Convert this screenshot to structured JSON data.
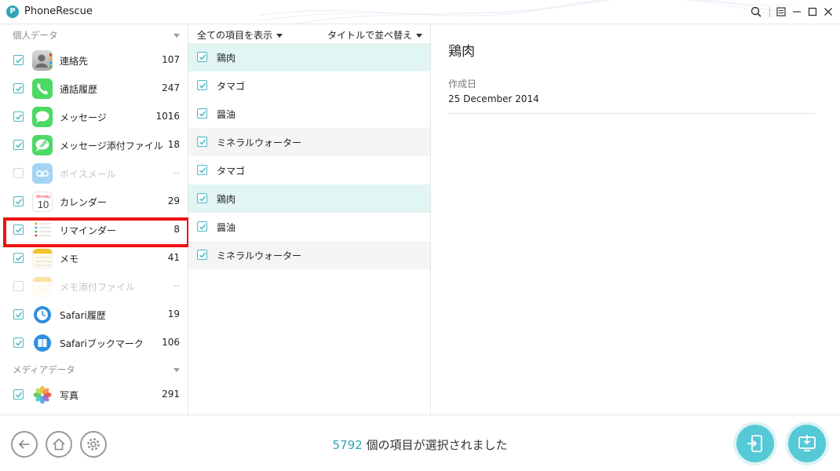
{
  "app": {
    "title": "PhoneRescue",
    "logo_letter": "P"
  },
  "sidebar": {
    "section_personal": "個人データ",
    "section_media": "メディアデータ",
    "items": [
      {
        "label": "連絡先",
        "count": "107",
        "icon": "contacts-icon",
        "checked": true
      },
      {
        "label": "通話履歴",
        "count": "247",
        "icon": "phone-icon",
        "checked": true
      },
      {
        "label": "メッセージ",
        "count": "1016",
        "icon": "messages-icon",
        "checked": true
      },
      {
        "label": "メッセージ添付ファイル",
        "count": "18",
        "icon": "message-attachment-icon",
        "checked": true
      },
      {
        "label": "ボイスメール",
        "count": "--",
        "icon": "voicemail-icon",
        "checked": false
      },
      {
        "label": "カレンダー",
        "count": "29",
        "icon": "calendar-icon",
        "checked": true
      },
      {
        "label": "リマインダー",
        "count": "8",
        "icon": "reminders-icon",
        "checked": true
      },
      {
        "label": "メモ",
        "count": "41",
        "icon": "notes-icon",
        "checked": true
      },
      {
        "label": "メモ添付ファイル",
        "count": "--",
        "icon": "notes-attachment-icon",
        "checked": false
      },
      {
        "label": "Safari履歴",
        "count": "19",
        "icon": "safari-history-icon",
        "checked": true
      },
      {
        "label": "Safariブックマーク",
        "count": "106",
        "icon": "safari-bookmark-icon",
        "checked": true
      }
    ],
    "media_items": [
      {
        "label": "写真",
        "count": "291",
        "icon": "photos-icon",
        "checked": true
      }
    ],
    "calendar_month": "Monday",
    "calendar_day": "10"
  },
  "list": {
    "filter_label": "全ての項目を表示",
    "sort_label": "タイトルで並べ替え",
    "items": [
      {
        "label": "鶏肉"
      },
      {
        "label": "タマゴ"
      },
      {
        "label": "醤油"
      },
      {
        "label": "ミネラルウォーター"
      },
      {
        "label": "タマゴ"
      },
      {
        "label": "鶏肉"
      },
      {
        "label": "醤油"
      },
      {
        "label": "ミネラルウォーター"
      }
    ]
  },
  "detail": {
    "title": "鶏肉",
    "created_label": "作成日",
    "created_value": "25 December 2014"
  },
  "footer": {
    "selected_count": "5792",
    "selected_text": " 個の項目が選択されました"
  },
  "colors": {
    "accent": "#2ea6b8",
    "action_button": "#55c9d6",
    "selected_row": "#e1f5f2",
    "highlight_box": "#ee1111"
  }
}
